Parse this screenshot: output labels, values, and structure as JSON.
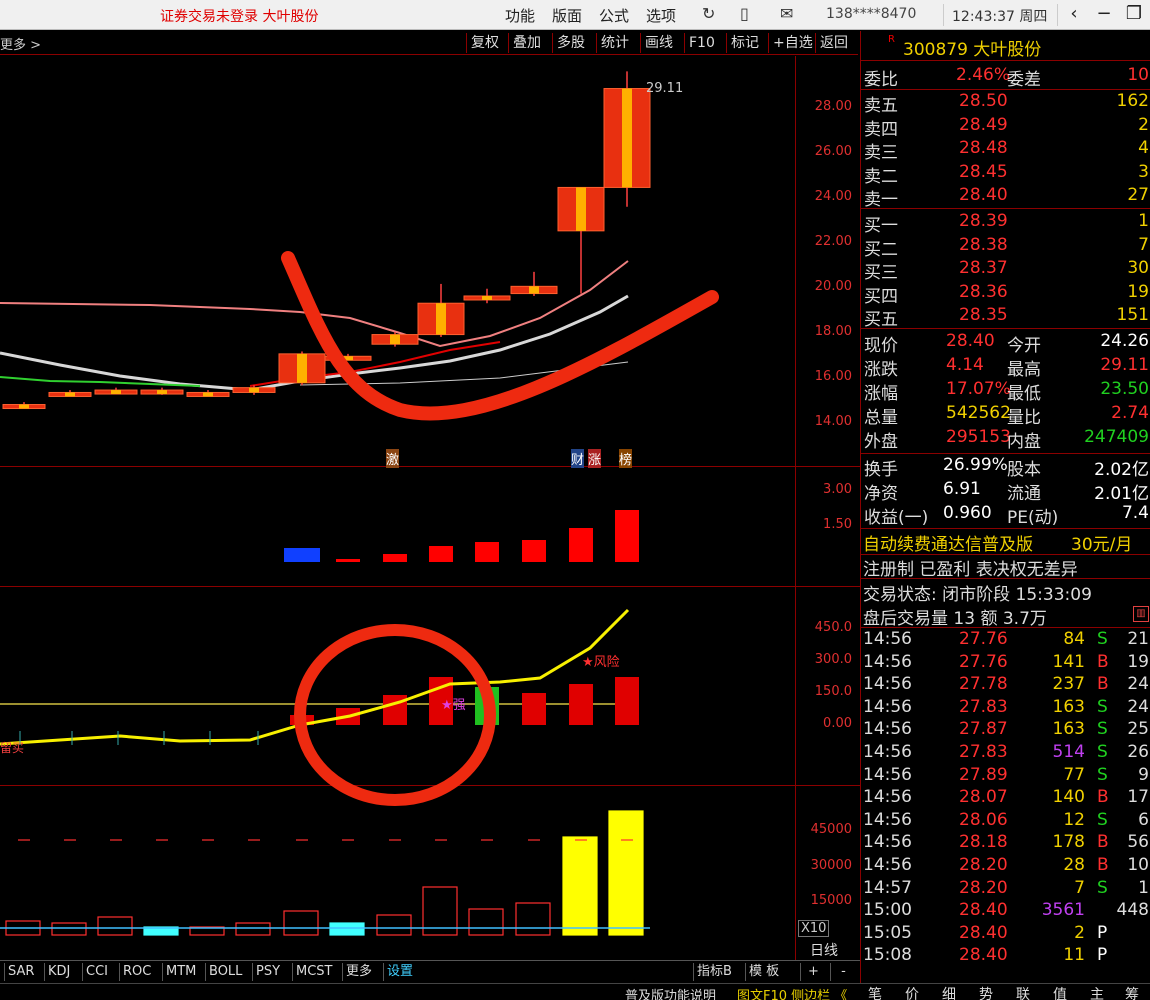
{
  "topbar": {
    "title": "证券交易未登录  大叶股份",
    "menus": [
      "功能",
      "版面",
      "公式",
      "选项"
    ],
    "phone": "138****8470",
    "time": "12:43:37 周四"
  },
  "toolbar": {
    "more": "更多 >",
    "buttons": [
      "复权",
      "叠加",
      "多股",
      "统计",
      "画线",
      "F10",
      "标记",
      "+自选",
      "返回"
    ]
  },
  "chart": {
    "high_label": "29.11",
    "price_axis": [
      "28.00",
      "26.00",
      "24.00",
      "22.00",
      "20.00",
      "18.00",
      "16.00",
      "14.00"
    ],
    "vol2_axis": [
      "3.00",
      "1.50"
    ],
    "ind_axis": [
      "450.0",
      "300.0",
      "150.0",
      "0.00"
    ],
    "vol_axis": [
      "45000",
      "30000",
      "15000"
    ],
    "vol_unit": "X10",
    "pins": [
      "激",
      "财",
      "涨",
      "榜"
    ],
    "ind_marks": {
      "risk": "★风险",
      "strong": "★强",
      "left_text": "留买"
    },
    "cycle": "日线"
  },
  "bottom_tabs": [
    "SAR",
    "KDJ",
    "CCI",
    "ROC",
    "MTM",
    "BOLL",
    "PSY",
    "MCST",
    "更多",
    "设置"
  ],
  "bottom_right": {
    "indicator": "指标B",
    "template": "模 板",
    "plus": "+",
    "minus": "-"
  },
  "statusbar": {
    "left": "普及版功能说明",
    "right": "图文F10 侧边栏 《"
  },
  "side_tabs": [
    "笔",
    "价",
    "细",
    "势",
    "联",
    "值",
    "主",
    "筹"
  ],
  "stock": {
    "r": "R",
    "code_name": "300879 大叶股份"
  },
  "wei": {
    "ratio_label": "委比",
    "ratio": "2.46%",
    "diff_label": "委差",
    "diff": "10"
  },
  "sells": [
    {
      "label": "卖五",
      "price": "28.50",
      "vol": "162"
    },
    {
      "label": "卖四",
      "price": "28.49",
      "vol": "2"
    },
    {
      "label": "卖三",
      "price": "28.48",
      "vol": "4"
    },
    {
      "label": "卖二",
      "price": "28.45",
      "vol": "3"
    },
    {
      "label": "卖一",
      "price": "28.40",
      "vol": "27"
    }
  ],
  "buys": [
    {
      "label": "买一",
      "price": "28.39",
      "vol": "1"
    },
    {
      "label": "买二",
      "price": "28.38",
      "vol": "7"
    },
    {
      "label": "买三",
      "price": "28.37",
      "vol": "30"
    },
    {
      "label": "买四",
      "price": "28.36",
      "vol": "19"
    },
    {
      "label": "买五",
      "price": "28.35",
      "vol": "151"
    }
  ],
  "quote": [
    {
      "l1": "现价",
      "v1": "28.40",
      "l2": "今开",
      "v2": "24.26",
      "c1": "red",
      "c2": "wht"
    },
    {
      "l1": "涨跌",
      "v1": "4.14",
      "l2": "最高",
      "v2": "29.11",
      "c1": "red",
      "c2": "red"
    },
    {
      "l1": "涨幅",
      "v1": "17.07%",
      "l2": "最低",
      "v2": "23.50",
      "c1": "red",
      "c2": "grn"
    },
    {
      "l1": "总量",
      "v1": "542562",
      "l2": "量比",
      "v2": "2.74",
      "c1": "yel",
      "c2": "red"
    },
    {
      "l1": "外盘",
      "v1": "295153",
      "l2": "内盘",
      "v2": "247409",
      "c1": "red",
      "c2": "grn"
    }
  ],
  "fund": [
    {
      "l1": "换手",
      "v1": "26.99%",
      "l2": "股本",
      "v2": "2.02亿"
    },
    {
      "l1": "净资",
      "v1": "6.91",
      "l2": "流通",
      "v2": "2.01亿"
    },
    {
      "l1": "收益(一)",
      "v1": "0.960",
      "l2": "PE(动)",
      "v2": "7.4"
    }
  ],
  "promo": {
    "text": "自动续费通达信普及版",
    "price": "30元/月"
  },
  "reg": "注册制 已盈利 表决权无差异",
  "trade_status": "交易状态: 闭市阶段 15:33:09",
  "after_hours": "盘后交易量 13 额 3.7万",
  "ticks": [
    {
      "t": "14:56",
      "p": "27.76",
      "v": "84",
      "s": "S",
      "n": "21",
      "vc": "yel"
    },
    {
      "t": "14:56",
      "p": "27.76",
      "v": "141",
      "s": "B",
      "n": "19",
      "vc": "yel"
    },
    {
      "t": "14:56",
      "p": "27.78",
      "v": "237",
      "s": "B",
      "n": "24",
      "vc": "yel"
    },
    {
      "t": "14:56",
      "p": "27.83",
      "v": "163",
      "s": "S",
      "n": "24",
      "vc": "yel"
    },
    {
      "t": "14:56",
      "p": "27.87",
      "v": "163",
      "s": "S",
      "n": "25",
      "vc": "yel"
    },
    {
      "t": "14:56",
      "p": "27.83",
      "v": "514",
      "s": "S",
      "n": "26",
      "vc": "mag"
    },
    {
      "t": "14:56",
      "p": "27.89",
      "v": "77",
      "s": "S",
      "n": "9",
      "vc": "yel"
    },
    {
      "t": "14:56",
      "p": "28.07",
      "v": "140",
      "s": "B",
      "n": "17",
      "vc": "yel"
    },
    {
      "t": "14:56",
      "p": "28.06",
      "v": "12",
      "s": "S",
      "n": "6",
      "vc": "yel"
    },
    {
      "t": "14:56",
      "p": "28.18",
      "v": "178",
      "s": "B",
      "n": "56",
      "vc": "yel"
    },
    {
      "t": "14:56",
      "p": "28.20",
      "v": "28",
      "s": "B",
      "n": "10",
      "vc": "yel"
    },
    {
      "t": "14:57",
      "p": "28.20",
      "v": "7",
      "s": "S",
      "n": "1",
      "vc": "yel"
    },
    {
      "t": "15:00",
      "p": "28.40",
      "v": "3561",
      "s": "",
      "n": "448",
      "vc": "mag"
    },
    {
      "t": "15:05",
      "p": "28.40",
      "v": "2",
      "s": "P",
      "n": "",
      "vc": "yel"
    },
    {
      "t": "15:08",
      "p": "28.40",
      "v": "11",
      "s": "P",
      "n": "",
      "vc": "yel"
    }
  ],
  "chart_data": {
    "type": "candlestick",
    "price_ylim": [
      13.0,
      29.5
    ],
    "candles": [
      {
        "o": 15.3,
        "c": 15.3,
        "h": 15.4,
        "l": 15.2
      },
      {
        "o": 15.8,
        "c": 15.8,
        "h": 15.9,
        "l": 15.7
      },
      {
        "o": 15.9,
        "c": 15.9,
        "h": 16.0,
        "l": 15.8
      },
      {
        "o": 15.8,
        "c": 15.9,
        "h": 16.0,
        "l": 15.7
      },
      {
        "o": 15.8,
        "c": 15.8,
        "h": 15.9,
        "l": 15.7
      },
      {
        "o": 15.8,
        "c": 16.0,
        "h": 16.1,
        "l": 15.7
      },
      {
        "o": 16.2,
        "c": 17.4,
        "h": 17.5,
        "l": 16.1
      },
      {
        "o": 17.3,
        "c": 17.3,
        "h": 17.4,
        "l": 17.2
      },
      {
        "o": 17.8,
        "c": 18.2,
        "h": 18.3,
        "l": 17.7
      },
      {
        "o": 18.2,
        "c": 19.5,
        "h": 20.3,
        "l": 18.1
      },
      {
        "o": 19.8,
        "c": 19.8,
        "h": 20.1,
        "l": 19.5
      },
      {
        "o": 19.9,
        "c": 20.2,
        "h": 20.8,
        "l": 19.8
      },
      {
        "o": 22.5,
        "c": 24.3,
        "h": 24.3,
        "l": 19.9
      },
      {
        "o": 24.3,
        "c": 28.4,
        "h": 29.11,
        "l": 23.5
      }
    ],
    "vol_values": [
      0,
      0,
      0,
      0,
      0,
      0,
      0,
      0,
      0,
      0,
      0,
      0,
      40000,
      50000
    ],
    "macd_values": [
      0,
      0,
      0,
      0,
      0,
      0,
      -0.4,
      0.15,
      0.4,
      0.8,
      1.0,
      1.1,
      1.7,
      2.6
    ]
  }
}
